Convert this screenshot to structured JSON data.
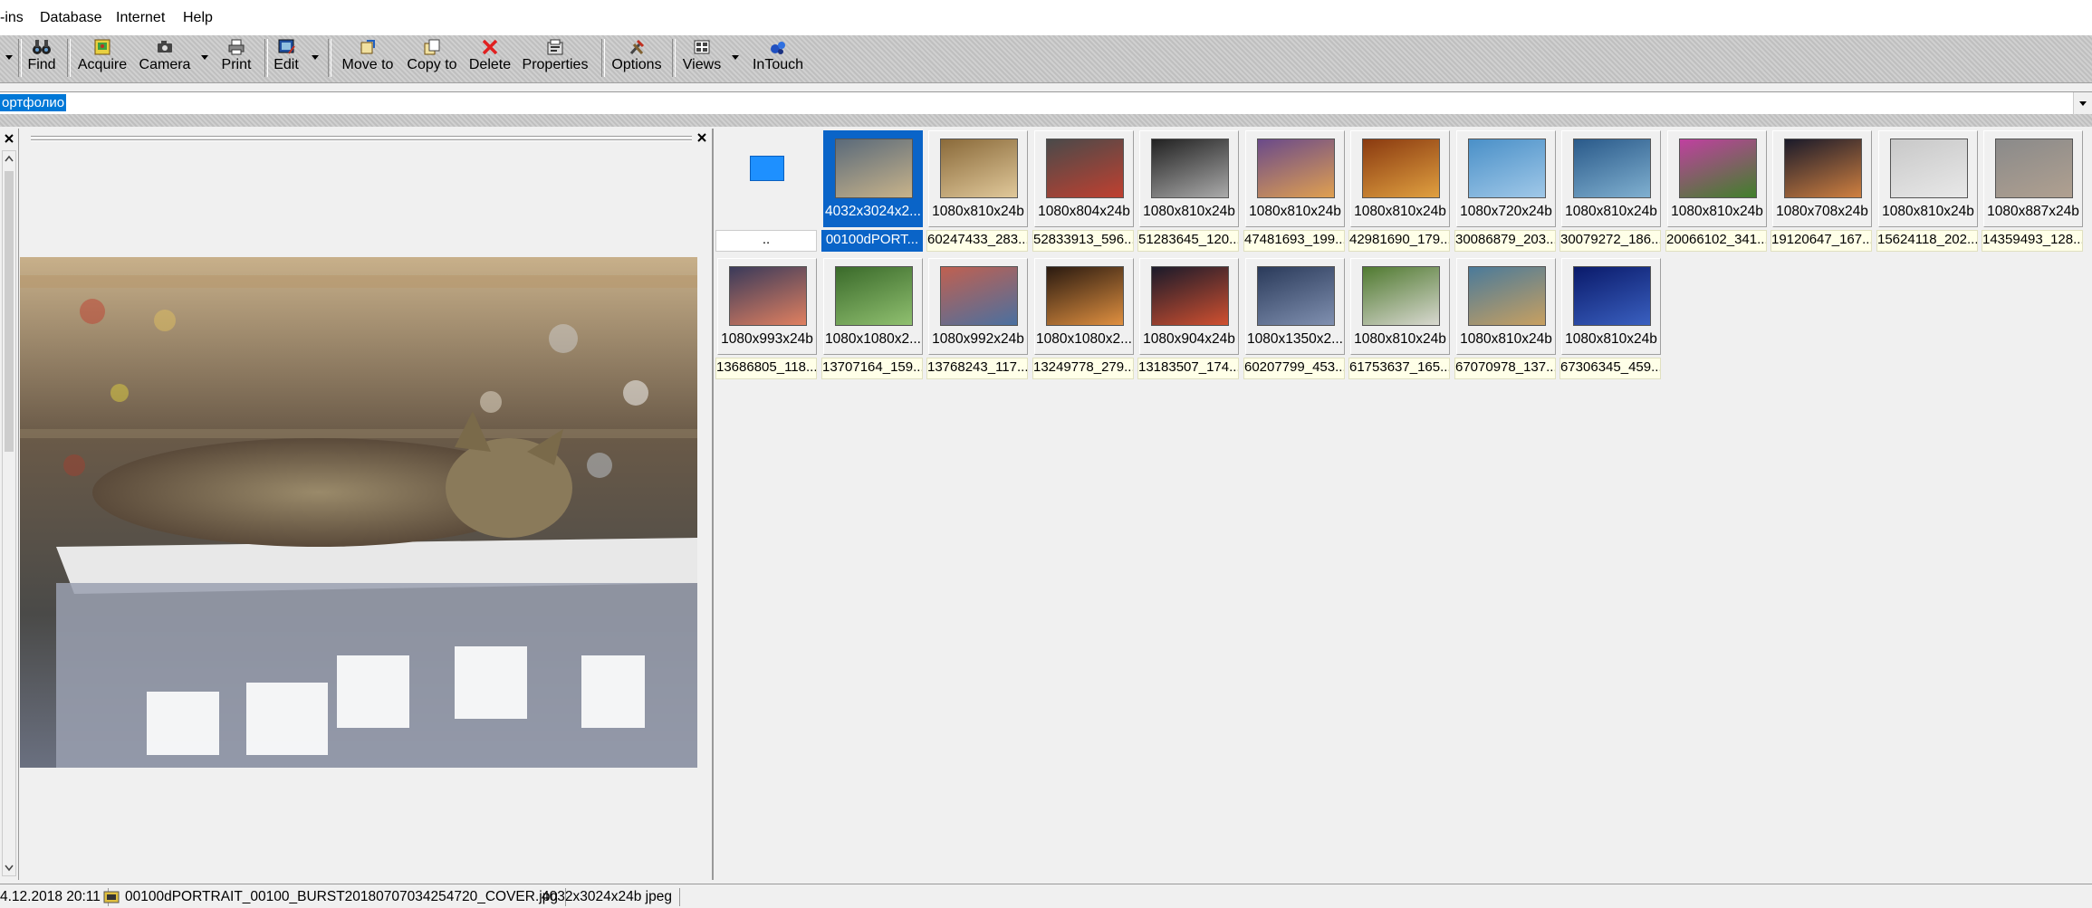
{
  "menu": {
    "items": [
      "-ins",
      "Database",
      "Internet",
      "Help"
    ]
  },
  "toolbar": {
    "find": "Find",
    "acquire": "Acquire",
    "camera": "Camera",
    "print": "Print",
    "edit": "Edit",
    "move_to": "Move to",
    "copy_to": "Copy to",
    "delete": "Delete",
    "properties": "Properties",
    "options": "Options",
    "views": "Views",
    "intouch": "InTouch"
  },
  "path": {
    "value": "ортфолио"
  },
  "browser": {
    "parent_label": "..",
    "thumbnails": [
      {
        "dims": "4032x3024x2...",
        "name": "00100dPORT...",
        "selected": true,
        "colors": [
          "#5a6a7a",
          "#c8b38a"
        ]
      },
      {
        "dims": "1080x810x24b",
        "name": "60247433_283...",
        "colors": [
          "#8a6a3a",
          "#e0c89a"
        ]
      },
      {
        "dims": "1080x804x24b",
        "name": "52833913_596...",
        "colors": [
          "#4a4a4a",
          "#c04030"
        ]
      },
      {
        "dims": "1080x810x24b",
        "name": "51283645_120...",
        "colors": [
          "#222222",
          "#aaaaaa"
        ]
      },
      {
        "dims": "1080x810x24b",
        "name": "47481693_199...",
        "colors": [
          "#6a4a8a",
          "#e0a050"
        ]
      },
      {
        "dims": "1080x810x24b",
        "name": "42981690_179...",
        "colors": [
          "#8a3a10",
          "#e0a040"
        ]
      },
      {
        "dims": "1080x720x24b",
        "name": "30086879_203...",
        "colors": [
          "#4a90c8",
          "#a0c8e8"
        ]
      },
      {
        "dims": "1080x810x24b",
        "name": "30079272_186...",
        "colors": [
          "#2a5a8a",
          "#80b0d0"
        ]
      },
      {
        "dims": "1080x810x24b",
        "name": "20066102_341...",
        "colors": [
          "#c040a0",
          "#40802a"
        ]
      },
      {
        "dims": "1080x708x24b",
        "name": "19120647_167...",
        "colors": [
          "#1a1a2a",
          "#d08040"
        ]
      },
      {
        "dims": "1080x810x24b",
        "name": "15624118_202...",
        "colors": [
          "#c8c8c8",
          "#e8e8e8"
        ]
      },
      {
        "dims": "1080x887x24b",
        "name": "14359493_128...",
        "colors": [
          "#8a8a8a",
          "#b0a090"
        ]
      },
      {
        "dims": "1080x993x24b",
        "name": "13686805_118...",
        "colors": [
          "#3a3a5a",
          "#e08060"
        ]
      },
      {
        "dims": "1080x1080x2...",
        "name": "13707164_159...",
        "colors": [
          "#3a6a2a",
          "#90c070"
        ]
      },
      {
        "dims": "1080x992x24b",
        "name": "13768243_117...",
        "colors": [
          "#c06050",
          "#4a70a0"
        ]
      },
      {
        "dims": "1080x1080x2...",
        "name": "13249778_279...",
        "colors": [
          "#2a1a10",
          "#e09040"
        ]
      },
      {
        "dims": "1080x904x24b",
        "name": "13183507_174...",
        "colors": [
          "#1a1a2a",
          "#d05030"
        ]
      },
      {
        "dims": "1080x1350x2...",
        "name": "60207799_453...",
        "colors": [
          "#2a3a5a",
          "#8090b0"
        ]
      },
      {
        "dims": "1080x810x24b",
        "name": "61753637_165...",
        "colors": [
          "#507a30",
          "#d8d8d0"
        ]
      },
      {
        "dims": "1080x810x24b",
        "name": "67070978_137...",
        "colors": [
          "#4a7a9a",
          "#c8a060"
        ]
      },
      {
        "dims": "1080x810x24b",
        "name": "67306345_459...",
        "colors": [
          "#0a1a6a",
          "#3a60c0"
        ]
      }
    ]
  },
  "status": {
    "datetime": "4.12.2018 20:11",
    "filename": "00100dPORTRAIT_00100_BURST20180707034254720_COVER.jpg",
    "info": "4032x3024x24b jpeg"
  },
  "colors": {
    "selection": "#0a64c8",
    "filename_bg": "#ffffe8",
    "toolbar_bg": "#c9c9c9"
  }
}
